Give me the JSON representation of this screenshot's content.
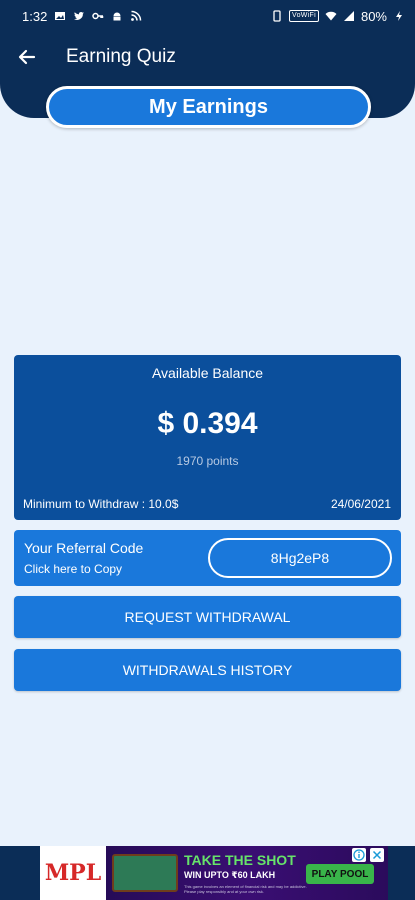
{
  "status_bar": {
    "time": "1:32",
    "volte": "VoWiFi",
    "battery": "80%"
  },
  "header": {
    "title": "Earning Quiz",
    "back_icon": "arrow-left-icon",
    "pill_label": "My Earnings"
  },
  "balance": {
    "label": "Available Balance",
    "amount": "$ 0.394",
    "points": "1970 points",
    "minimum": "Minimum to Withdraw : 10.0$",
    "date": "24/06/2021"
  },
  "referral": {
    "title": "Your Referral Code",
    "subtitle": "Click here to Copy",
    "code": "8Hg2eP8"
  },
  "buttons": {
    "request_withdrawal": "REQUEST WITHDRAWAL",
    "withdrawals_history": "WITHDRAWALS HISTORY"
  },
  "ad": {
    "brand": "MPL",
    "headline": "TAKE THE SHOT",
    "subline": "WIN UPTO ₹60 LAKH",
    "fine_print": "This game involves an element of financial risk and may be addictive. Please play responsibly and at your own risk.",
    "cta": "PLAY POOL"
  },
  "colors": {
    "navy": "#0b2d57",
    "card_dark": "#0b4f9c",
    "accent": "#1a78db",
    "background": "#e9f2fc"
  }
}
